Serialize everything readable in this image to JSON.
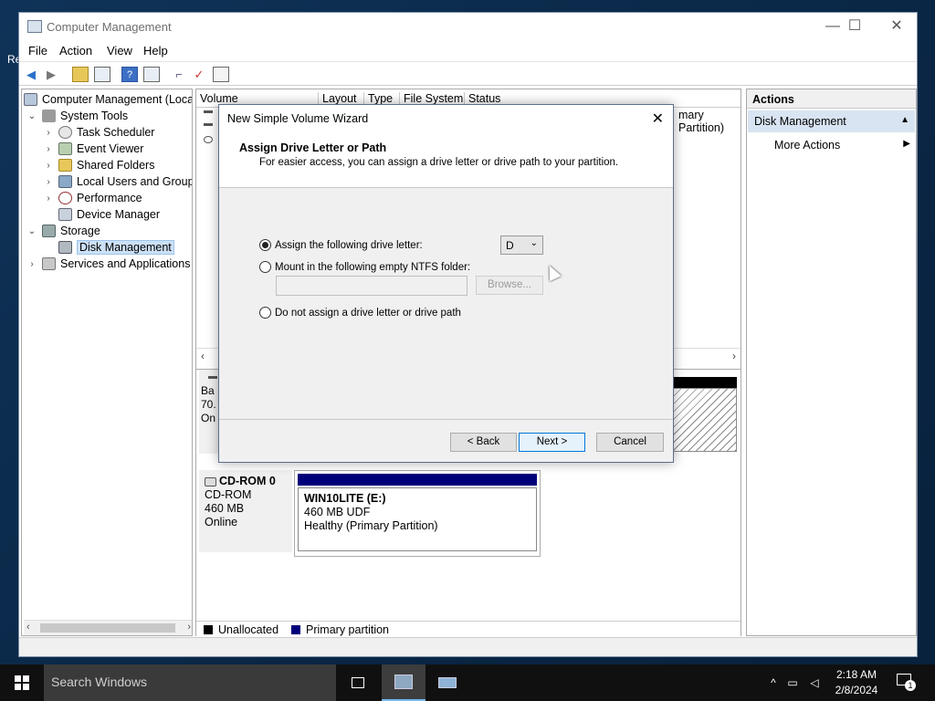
{
  "desktop": {
    "partial_label": "Re"
  },
  "window": {
    "title": "Computer Management",
    "controls": {
      "minimize": "—",
      "maximize": "☐",
      "close": "✕"
    }
  },
  "menu": [
    "File",
    "Action",
    "View",
    "Help"
  ],
  "tree": {
    "items": [
      {
        "label": "Computer Management (Local",
        "level": 0,
        "expander": ""
      },
      {
        "label": "System Tools",
        "level": 1,
        "expander": "⌄"
      },
      {
        "label": "Task Scheduler",
        "level": 2,
        "expander": "›"
      },
      {
        "label": "Event Viewer",
        "level": 2,
        "expander": "›"
      },
      {
        "label": "Shared Folders",
        "level": 2,
        "expander": "›"
      },
      {
        "label": "Local Users and Groups",
        "level": 2,
        "expander": "›"
      },
      {
        "label": "Performance",
        "level": 2,
        "expander": "›"
      },
      {
        "label": "Device Manager",
        "level": 2,
        "expander": ""
      },
      {
        "label": "Storage",
        "level": 1,
        "expander": "⌄"
      },
      {
        "label": "Disk Management",
        "level": 2,
        "expander": "",
        "selected": true
      },
      {
        "label": "Services and Applications",
        "level": 1,
        "expander": "›"
      }
    ]
  },
  "volume_list": {
    "columns": [
      "Volume",
      "Layout",
      "Type",
      "File System",
      "Status"
    ],
    "partial_status": "mary Partition)"
  },
  "disk0": {
    "lines": [
      "Ba",
      "70.",
      "On"
    ]
  },
  "cdrom": {
    "name": "CD-ROM 0",
    "type": "CD-ROM",
    "size": "460 MB",
    "status": "Online",
    "partition": {
      "name": "WIN10LITE  (E:)",
      "size_fs": "460 MB UDF",
      "health": "Healthy (Primary Partition)"
    }
  },
  "legend": [
    {
      "label": "Unallocated",
      "color": "#000000"
    },
    {
      "label": "Primary partition",
      "color": "#00007a"
    }
  ],
  "actions": {
    "header": "Actions",
    "section": "Disk Management",
    "more": "More Actions"
  },
  "dialog": {
    "title": "New Simple Volume Wizard",
    "close": "✕",
    "heading": "Assign Drive Letter or Path",
    "subheading": "For easier access, you can assign a drive letter or drive path to your partition.",
    "option_letter": "Assign the following drive letter:",
    "option_folder": "Mount in the following empty NTFS folder:",
    "option_none": "Do not assign a drive letter or drive path",
    "drive_letter": "D",
    "browse": "Browse...",
    "back": "< Back",
    "next": "Next >",
    "cancel": "Cancel"
  },
  "taskbar": {
    "search_placeholder": "Search Windows",
    "time": "2:18 AM",
    "date": "2/8/2024",
    "notification_count": "1"
  }
}
